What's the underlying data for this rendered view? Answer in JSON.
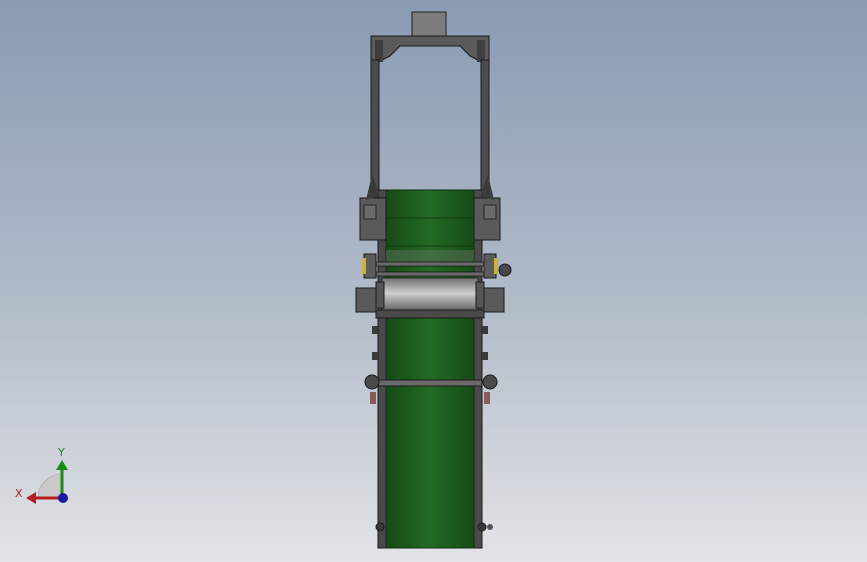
{
  "viewport": {
    "background_top": "#8a9bb3",
    "background_bottom": "#e2e4e7"
  },
  "model": {
    "belt_color": "#1f5e1f",
    "frame_color": "#4a4a4a"
  },
  "triad": {
    "x_label": "X",
    "y_label": "Y",
    "x_color": "#b02020",
    "y_color": "#1a8a1a",
    "z_color": "#1a1aa0"
  }
}
